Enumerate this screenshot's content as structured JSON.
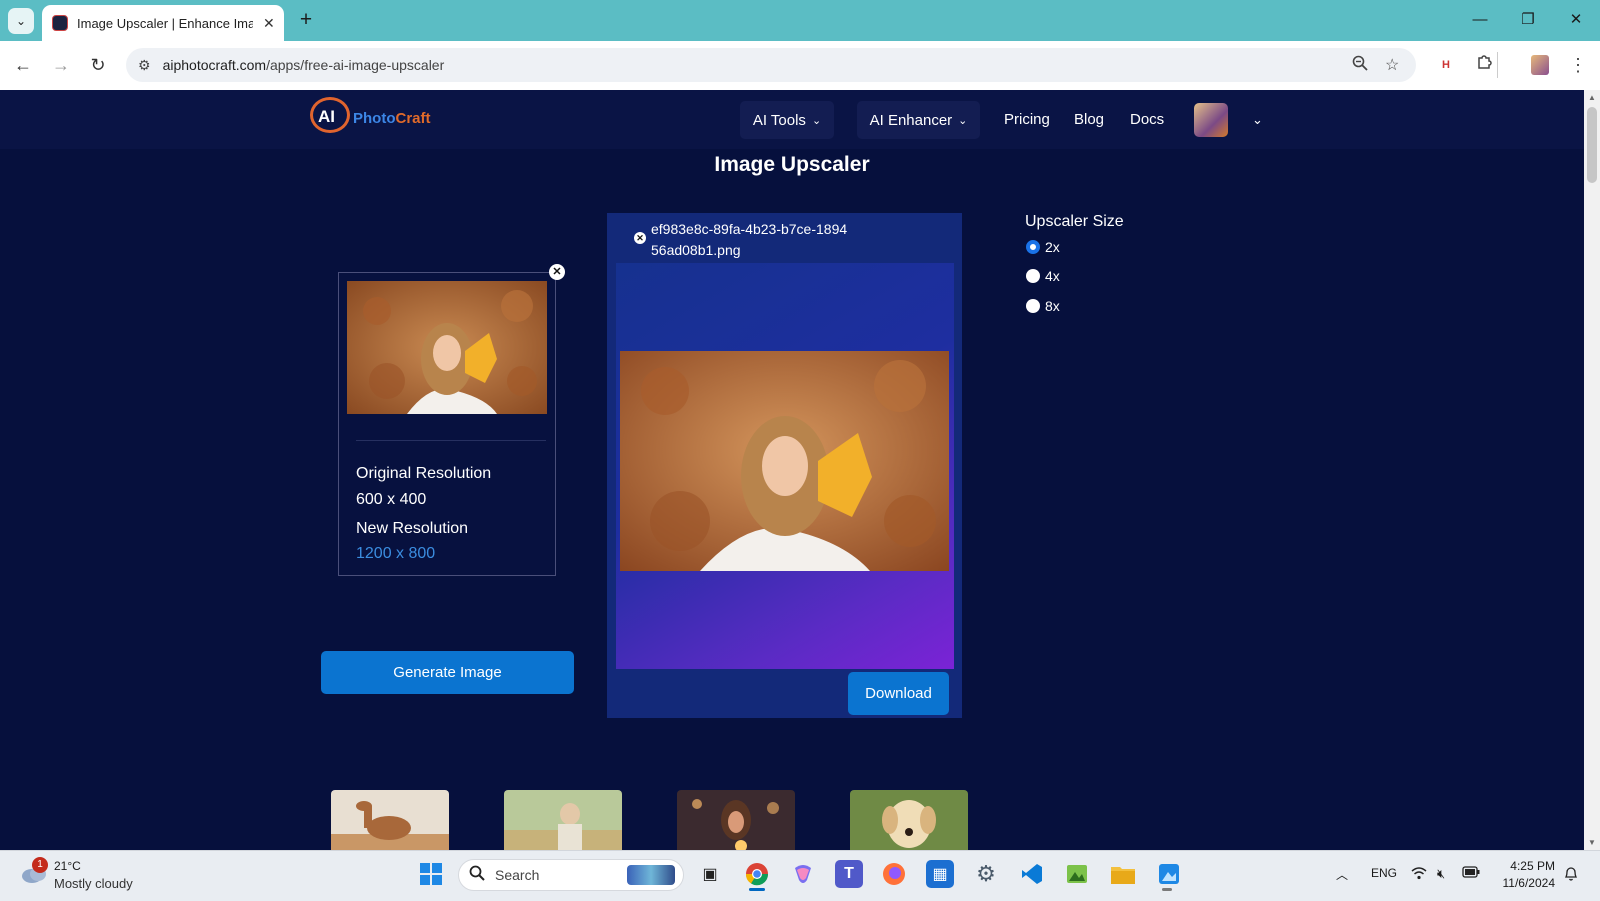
{
  "browser": {
    "tab_title": "Image Upscaler | Enhance Imag",
    "url_domain": "aiphotocraft.com",
    "url_path": "/apps/free-ai-image-upscaler",
    "icons": [
      "tab-list-icon",
      "close-icon",
      "new-tab-icon",
      "minimize-icon",
      "restore-icon",
      "window-close-icon",
      "back-icon",
      "forward-icon",
      "reload-icon",
      "site-info-icon",
      "zoom-icon",
      "bookmark-star-icon",
      "extension-icon",
      "puzzle-icon",
      "profile-icon",
      "menu-icon"
    ]
  },
  "site": {
    "logo_ai": "AI",
    "logo_photo": "Photo",
    "logo_craft": "Craft",
    "nav": {
      "ai_tools": "AI Tools",
      "ai_enhancer": "AI Enhancer",
      "pricing": "Pricing",
      "blog": "Blog",
      "docs": "Docs"
    }
  },
  "main": {
    "title": "Image Upscaler",
    "original_card": {
      "original_label": "Original Resolution",
      "original_value": "600 x 400",
      "new_label": "New Resolution",
      "new_value": "1200 x 800"
    },
    "generate_button": "Generate Image",
    "result": {
      "file_name": "ef983e8c-89fa-4b23-b7ce-189456ad08b1.png",
      "download_button": "Download"
    },
    "upscaler": {
      "title": "Upscaler Size",
      "options": [
        "2x",
        "4x",
        "8x"
      ],
      "selected": "2x"
    },
    "samples": [
      "camel",
      "child-in-field",
      "woman-with-lights",
      "puppy"
    ]
  },
  "taskbar": {
    "weather_badge": "1",
    "weather_temp": "21°C",
    "weather_desc": "Mostly cloudy",
    "search_label": "Search",
    "language": "ENG",
    "time": "4:25 PM",
    "date": "11/6/2024"
  },
  "colors": {
    "page_bg": "#06103d",
    "header_bg": "#0a1445",
    "primary_button": "#0b74d0",
    "accent_blue_text": "#3b8de0",
    "tab_strip": "#5bbdc4"
  }
}
